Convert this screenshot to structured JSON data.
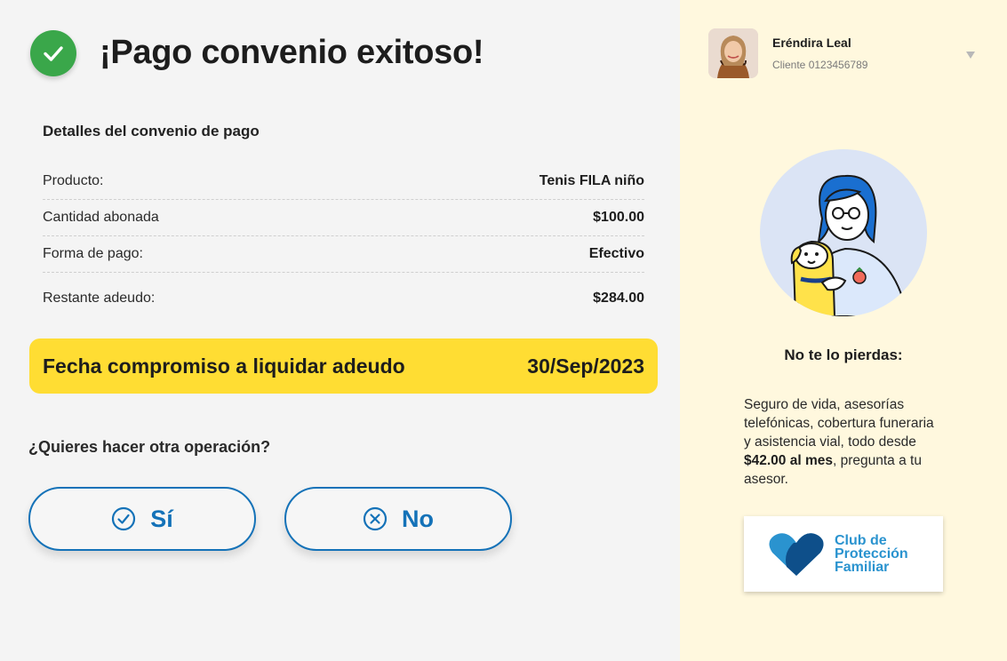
{
  "header": {
    "title": "¡Pago convenio exitoso!",
    "success_icon": "check-circle-icon"
  },
  "details": {
    "title": "Detalles del convenio de pago",
    "rows": [
      {
        "label": "Producto:",
        "value": "Tenis FILA niño"
      },
      {
        "label": "Cantidad abonada",
        "value": "$100.00"
      },
      {
        "label": "Forma de pago:",
        "value": "Efectivo"
      },
      {
        "label": "Restante adeudo:",
        "value": "$284.00"
      }
    ]
  },
  "commitment": {
    "label": "Fecha compromiso a liquidar adeudo",
    "date": "30/Sep/2023"
  },
  "question": "¿Quieres hacer otra operación?",
  "actions": {
    "yes_label": "Sí",
    "no_label": "No"
  },
  "user": {
    "name": "Eréndira Leal",
    "client_id": "Cliente 0123456789"
  },
  "promo": {
    "title": "No te lo pierdas:",
    "text_before": "Seguro de vida, asesorías telefónicas, cobertura funeraria y asistencia vial, todo desde ",
    "price": "$42.00 al mes",
    "text_after": ", pregunta a tu asesor.",
    "logo_line1": "Club de",
    "logo_line2": "Protección",
    "logo_line3": "Familiar"
  },
  "colors": {
    "accent_blue": "#1472b8",
    "success_green": "#3aa74a",
    "highlight_yellow": "#ffdd33",
    "sidebar_bg": "#fff8de"
  }
}
